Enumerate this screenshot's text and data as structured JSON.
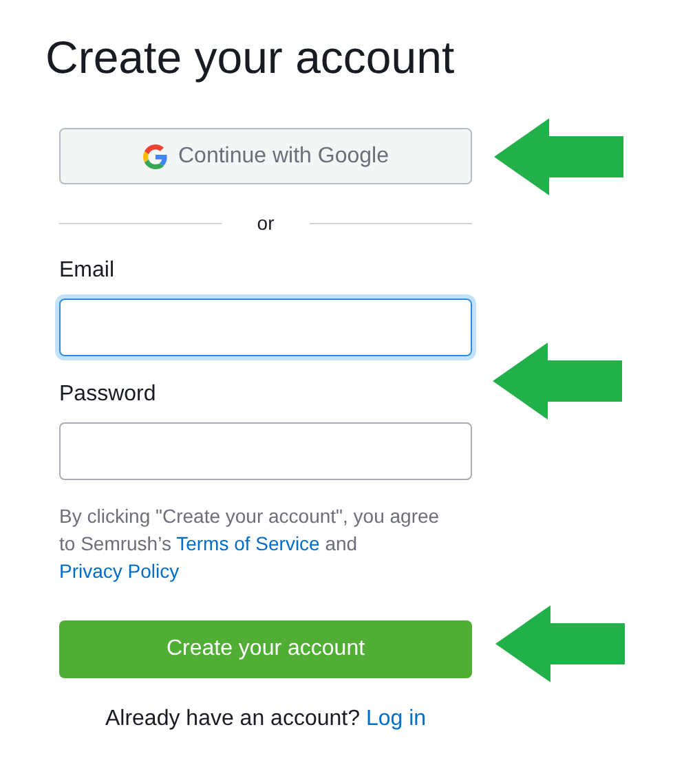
{
  "title": "Create your account",
  "google_button": {
    "label": "Continue with Google"
  },
  "divider": {
    "label": "or"
  },
  "fields": [
    {
      "label": "Email",
      "focused": true
    },
    {
      "label": "Password",
      "focused": false
    }
  ],
  "consent": {
    "text": "By clicking \"Create your account\", you agree to Semrush’s",
    "terms_link": "Terms of Service",
    "joiner": "and",
    "privacy_link": "Privacy Policy"
  },
  "submit_button": {
    "label": "Create your account"
  },
  "login_prompt": {
    "text": "Already have an account?",
    "link": "Log in"
  },
  "annotations": [
    {
      "kind": "arrow"
    },
    {
      "kind": "arrow"
    },
    {
      "kind": "arrow"
    }
  ]
}
